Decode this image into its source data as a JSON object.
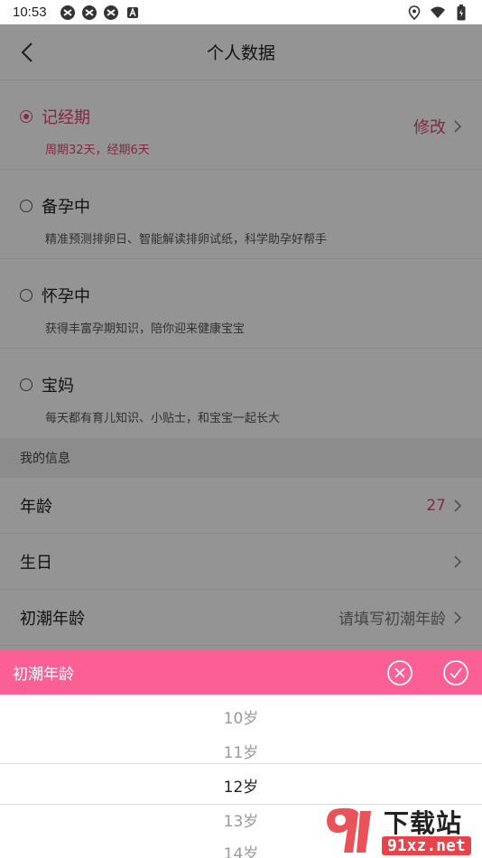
{
  "status_bar": {
    "time": "10:53"
  },
  "header": {
    "title": "个人数据"
  },
  "status_options": [
    {
      "name": "记经期",
      "desc": "周期32天，经期6天",
      "checked": true
    },
    {
      "name": "备孕中",
      "desc": "精准预测排卵日、智能解读排卵试纸，科学助孕好帮手",
      "checked": false
    },
    {
      "name": "怀孕中",
      "desc": "获得丰富孕期知识，陪你迎来健康宝宝",
      "checked": false
    },
    {
      "name": "宝妈",
      "desc": "每天都有育儿知识、小贴士，和宝宝一起长大",
      "checked": false
    }
  ],
  "edit_label": "修改",
  "section": {
    "title": "我的信息"
  },
  "info": {
    "age_label": "年龄",
    "age_value": "27",
    "birthday_label": "生日",
    "birthday_value": "",
    "menarche_label": "初潮年龄",
    "menarche_value": "请填写初潮年龄"
  },
  "picker": {
    "title": "初潮年龄",
    "options": [
      "10岁",
      "11岁",
      "12岁",
      "13岁",
      "14岁"
    ],
    "selected_index": 2
  },
  "watermark": {
    "text": "下载站",
    "site": "91xz.net"
  },
  "colors": {
    "accent": "#d94d73",
    "picker_bar": "#fc5e96"
  }
}
